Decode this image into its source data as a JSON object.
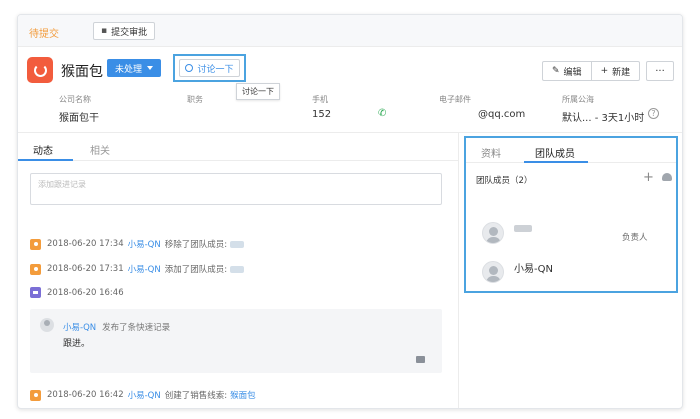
{
  "header": {
    "status": "待提交",
    "submit_label": "提交审批",
    "customer_name": "猴面包",
    "stage_label": "未处理",
    "discuss_label": "讨论一下",
    "tooltip": "讨论一下",
    "actions": {
      "edit": "编辑",
      "new": "新建",
      "more": "···"
    }
  },
  "fields": {
    "company": {
      "label": "公司名称",
      "value": "猴面包干"
    },
    "position": {
      "label": "职务",
      "value": ""
    },
    "phone": {
      "label": "手机",
      "value": "152"
    },
    "email": {
      "label": "电子邮件",
      "value": "@qq.com"
    },
    "pool": {
      "label": "所属公海",
      "value": "默认... - 3天1小时"
    }
  },
  "left_tabs": [
    "动态",
    "相关"
  ],
  "followup_placeholder": "添加跟进记录",
  "logs": [
    {
      "time": "2018-06-20 17:34",
      "user": "小易-QN",
      "action": "移除了团队成员:"
    },
    {
      "time": "2018-06-20 17:31",
      "user": "小易-QN",
      "action": "添加了团队成员:"
    },
    {
      "time": "2018-06-20 16:46"
    },
    {
      "time": "2018-06-20 16:42",
      "user": "小易-QN",
      "action": "创建了销售线索:",
      "target": "猴面包"
    }
  ],
  "note": {
    "user": "小易-QN",
    "action": "发布了条快速记录",
    "body": "跟进。"
  },
  "right_tabs": [
    "资料",
    "团队成员"
  ],
  "members_title": "团队成员（2）",
  "members": [
    {
      "name": "",
      "role": "负责人"
    },
    {
      "name": "小易-QN",
      "role": ""
    }
  ],
  "icons": [
    "submit-icon",
    "logo-icon",
    "caret-down-icon",
    "chat-bubble-icon",
    "pencil-icon",
    "plus-icon",
    "phone-icon",
    "help-icon",
    "pin-icon",
    "note-icon",
    "comment-icon",
    "add-icon",
    "settings-icon",
    "avatar-icon"
  ],
  "colors": {
    "accent": "#3a8ee6",
    "status": "#f39c3c",
    "logo": "#f25c3d",
    "highlight": "#4ba3e0",
    "phone": "#2eaa55"
  }
}
